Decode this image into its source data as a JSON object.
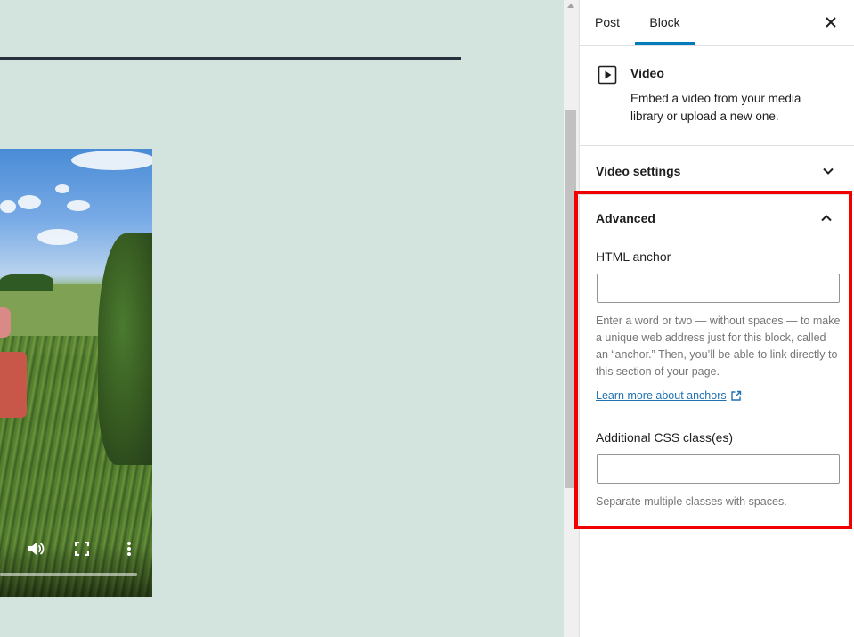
{
  "canvas": {
    "background": "#d3e4df",
    "video": {
      "controls": {
        "volume_icon": "volume-icon",
        "fullscreen_icon": "fullscreen-icon",
        "more_icon": "more-vertical-icon"
      }
    }
  },
  "sidebar": {
    "tabs": [
      {
        "label": "Post",
        "active": false
      },
      {
        "label": "Block",
        "active": true
      }
    ],
    "close_icon": "close-icon",
    "block_card": {
      "icon": "video-icon",
      "title": "Video",
      "description": "Embed a video from your media library or upload a new one."
    },
    "video_settings": {
      "title": "Video settings",
      "expanded": false
    },
    "advanced": {
      "title": "Advanced",
      "expanded": true,
      "html_anchor": {
        "label": "HTML anchor",
        "value": "",
        "help": "Enter a word or two — without spaces — to make a unique web address just for this block, called an “anchor.” Then, you’ll be able to link directly to this section of your page.",
        "link_label": "Learn more about anchors"
      },
      "css_classes": {
        "label": "Additional CSS class(es)",
        "value": "",
        "help": "Separate multiple classes with spaces."
      }
    }
  },
  "colors": {
    "accent": "#007cba",
    "highlight": "#f20000",
    "link": "#2271b1"
  }
}
